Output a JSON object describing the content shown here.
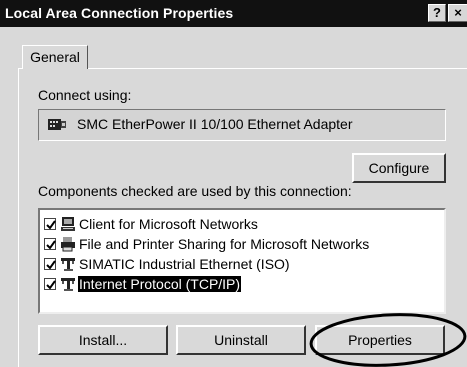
{
  "window": {
    "title": "Local Area Connection Properties",
    "help_label": "?",
    "close_label": "×"
  },
  "tabs": [
    {
      "label": "General",
      "active": true
    }
  ],
  "connect_using": {
    "label": "Connect using:",
    "adapter_name": "SMC EtherPower II 10/100 Ethernet Adapter",
    "adapter_icon": "network-adapter-icon"
  },
  "configure_button": "Configure",
  "components": {
    "label": "Components checked are used by this connection:",
    "items": [
      {
        "label": "Client for Microsoft Networks",
        "checked": true,
        "icon": "computer-icon",
        "selected": false
      },
      {
        "label": "File and Printer Sharing for Microsoft Networks",
        "checked": true,
        "icon": "printer-icon",
        "selected": false
      },
      {
        "label": "SIMATIC Industrial Ethernet (ISO)",
        "checked": true,
        "icon": "protocol-icon",
        "selected": false
      },
      {
        "label": "Internet Protocol (TCP/IP)",
        "checked": true,
        "icon": "protocol-icon",
        "selected": true
      }
    ]
  },
  "buttons": {
    "install": "Install...",
    "uninstall": "Uninstall",
    "properties": "Properties"
  },
  "colors": {
    "titlebar": "#111111",
    "dialog_face": "#d9d9d9",
    "selection": "#000000"
  }
}
